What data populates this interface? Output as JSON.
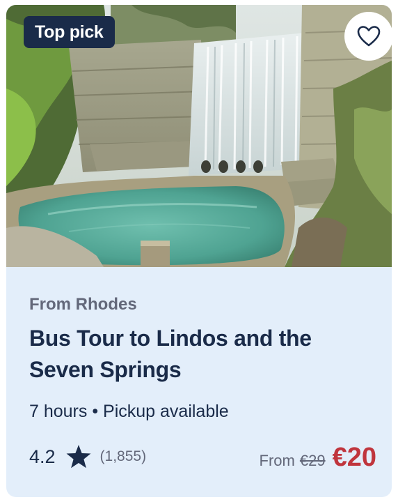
{
  "badge": {
    "label": "Top pick"
  },
  "favorite": {
    "icon": "heart-icon"
  },
  "photo": {
    "subject": "waterfall-pool-photo"
  },
  "tour": {
    "from_city": "From Rhodes",
    "title": "Bus Tour to Lindos and the Seven Springs",
    "details": "7 hours • Pickup available"
  },
  "rating": {
    "value": "4.2",
    "icon": "star-icon",
    "count": "(1,855)"
  },
  "price": {
    "from_label": "From",
    "old_price": "€29",
    "new_price": "€20"
  },
  "colors": {
    "navy": "#1a2b49",
    "card_background": "#e3eefa",
    "price_red": "#c0353d",
    "muted_gray": "#63687a"
  }
}
